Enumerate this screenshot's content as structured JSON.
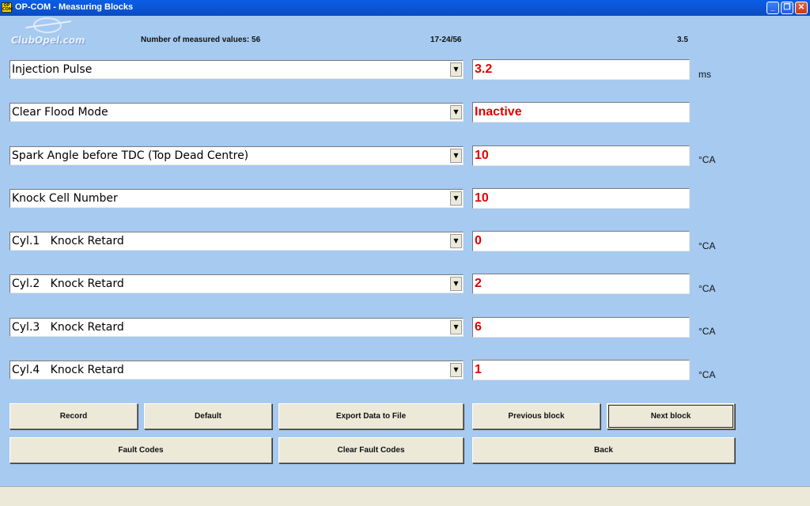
{
  "window": {
    "icon_text": "OP COM",
    "title": "OP-COM - Measuring Blocks",
    "controls": {
      "minimize": "_",
      "maximize": "❐",
      "close": "✕"
    }
  },
  "logo": {
    "text": "ClubOpel.com"
  },
  "info": {
    "measured_values": "Number of measured values: 56",
    "range": "17-24/56",
    "version": "3.5"
  },
  "rows": [
    {
      "label": "Injection Pulse",
      "value": "3.2",
      "unit": "ms"
    },
    {
      "label": "Clear Flood Mode",
      "value": "Inactive",
      "unit": ""
    },
    {
      "label": "Spark Angle before TDC (Top Dead Centre)",
      "value": "10",
      "unit": "°CA"
    },
    {
      "label": "Knock Cell Number",
      "value": "10",
      "unit": ""
    },
    {
      "label": "Cyl.1   Knock Retard",
      "value": "0",
      "unit": "°CA"
    },
    {
      "label": "Cyl.2   Knock Retard",
      "value": "2",
      "unit": "°CA"
    },
    {
      "label": "Cyl.3   Knock Retard",
      "value": "6",
      "unit": "°CA"
    },
    {
      "label": "Cyl.4   Knock Retard",
      "value": "1",
      "unit": "°CA"
    }
  ],
  "dropdown_arrow": "▼",
  "buttons": {
    "record": "Record",
    "default": "Default",
    "export": "Export Data to File",
    "previous": "Previous block",
    "next": "Next block",
    "fault_codes": "Fault Codes",
    "clear_fault_codes": "Clear Fault Codes",
    "back": "Back"
  },
  "colors": {
    "background": "#a6caf0",
    "value_text": "#e00000",
    "button_face": "#ece9d8",
    "titlebar": "#0a5fe6"
  }
}
